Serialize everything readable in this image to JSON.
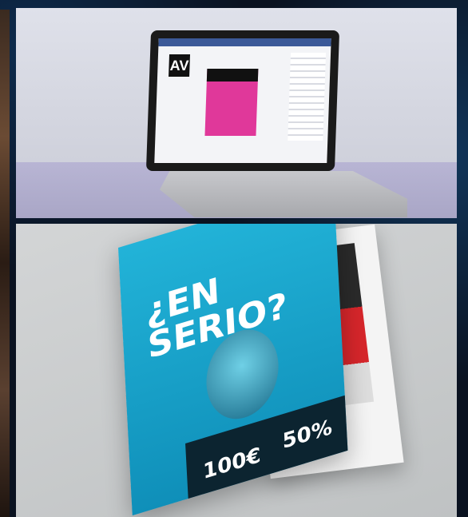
{
  "scene": {
    "top_photo": "laptop showing a social network page",
    "bottom_photo": "open magazine spread"
  },
  "magazine": {
    "headline": "¿EN SERIO?",
    "prices": [
      "100€",
      "50%"
    ]
  },
  "colors": {
    "background": "#0b1320",
    "cover_blue": "#22b3d8",
    "pink": "#e0389a"
  }
}
